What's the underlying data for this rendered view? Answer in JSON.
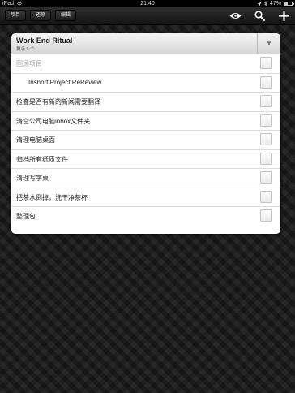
{
  "status_bar": {
    "carrier": "iPad",
    "time": "21:40",
    "battery_text": "47%",
    "battery_level": 0.47
  },
  "toolbar": {
    "buttons": [
      "项目",
      "还原",
      "编辑"
    ],
    "icons": [
      "eye-icon",
      "search-icon",
      "plus-icon"
    ]
  },
  "panel": {
    "title": "Work End Ritual",
    "subtitle": "剩余 9 个",
    "toggle_icon": "▼",
    "tasks": [
      {
        "label": "回顾项目",
        "dim": true,
        "indent": false
      },
      {
        "label": "Inshort Project ReReview",
        "dim": false,
        "indent": true
      },
      {
        "label": "检查是否有新的新闻需要翻译",
        "dim": false,
        "indent": false
      },
      {
        "label": "清空公司电脑inbox文件夹",
        "dim": false,
        "indent": false
      },
      {
        "label": "清理电脑桌面",
        "dim": false,
        "indent": false
      },
      {
        "label": "归档所有纸质文件",
        "dim": false,
        "indent": false
      },
      {
        "label": "清理写字桌",
        "dim": false,
        "indent": false
      },
      {
        "label": "把茶水倒掉，洗干净茶杯",
        "dim": false,
        "indent": false
      },
      {
        "label": "整理包",
        "dim": false,
        "indent": false
      }
    ]
  }
}
